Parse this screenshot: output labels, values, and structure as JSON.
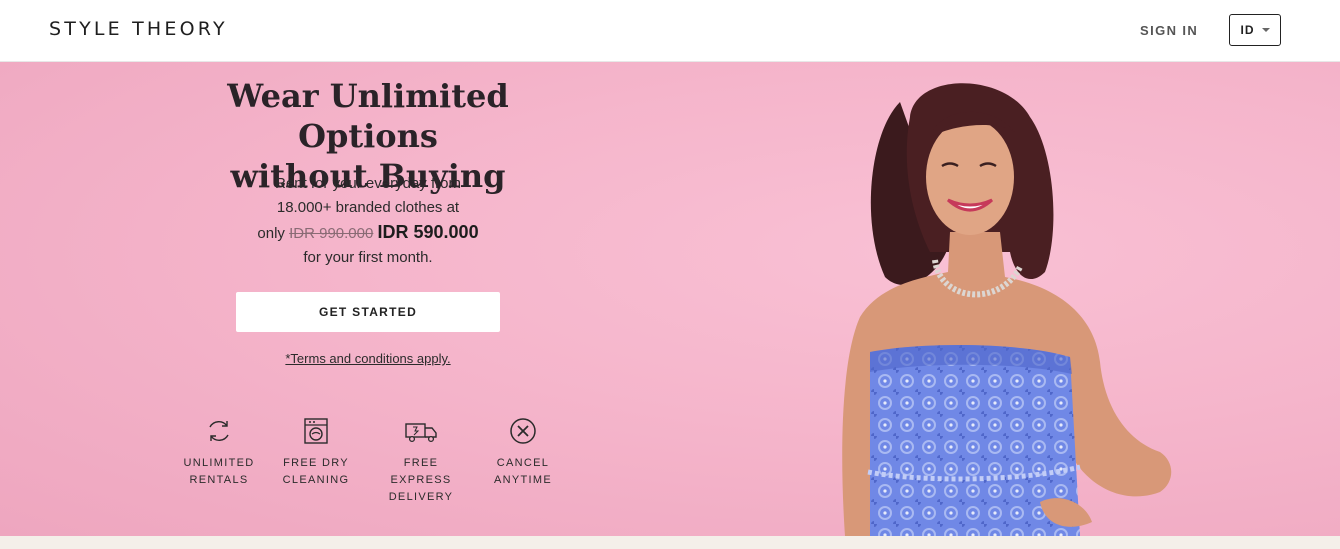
{
  "header": {
    "logo": "STYLE THEORY",
    "sign_in": "SIGN IN",
    "language": "ID"
  },
  "hero": {
    "headline_line1": "Wear Unlimited Options",
    "headline_line2": "without Buying",
    "sub_line1": "Rent for your everyday from",
    "sub_line2": "18.000+ branded clothes at",
    "sub_only": "only",
    "old_price": "IDR 990.000",
    "new_price": "IDR 590.000",
    "sub_line4": "for your first month.",
    "cta": "GET STARTED",
    "terms": "*Terms and conditions apply."
  },
  "features": [
    {
      "icon": "refresh-icon",
      "line1": "UNLIMITED",
      "line2": "RENTALS"
    },
    {
      "icon": "washing-machine-icon",
      "line1": "FREE DRY",
      "line2": "CLEANING"
    },
    {
      "icon": "delivery-truck-icon",
      "line1": "FREE EXPRESS",
      "line2": "DELIVERY"
    },
    {
      "icon": "cancel-icon",
      "line1": "CANCEL",
      "line2": "ANYTIME"
    }
  ],
  "colors": {
    "hero_background": "#f5b5cb",
    "cta_background": "#ffffff",
    "text": "#2b2b2b",
    "dress": "#6f86e6"
  }
}
